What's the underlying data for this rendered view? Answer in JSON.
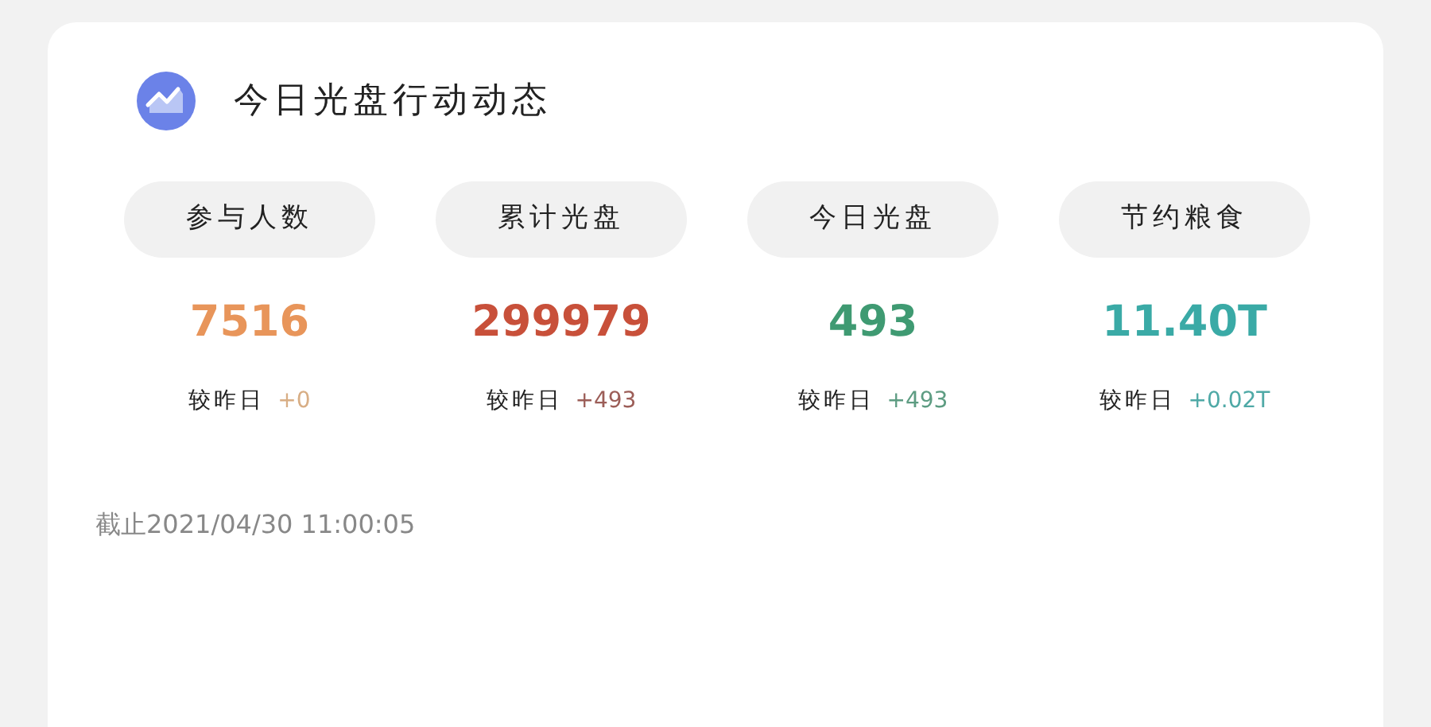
{
  "title": "今日光盘行动动态",
  "stats": [
    {
      "label": "参与人数",
      "value": "7516",
      "color": "#e8955a",
      "compare_label": "较昨日",
      "delta": {
        "text": "+0",
        "color": "#d8ae85"
      }
    },
    {
      "label": "累计光盘",
      "value": "299979",
      "color": "#c8503a",
      "compare_label": "较昨日",
      "delta": {
        "text": "+493",
        "color": "#9c5e58"
      }
    },
    {
      "label": "今日光盘",
      "value": "493",
      "color": "#3f9a72",
      "compare_label": "较昨日",
      "delta": {
        "text": "+493",
        "color": "#5d9c82"
      }
    },
    {
      "label": "节约粮食",
      "value": "11.40T",
      "color": "#3aaaa6",
      "compare_label": "较昨日",
      "delta": {
        "text": "+0.02T",
        "color": "#4fa9a6"
      }
    }
  ],
  "as_of": "截止2021/04/30 11:00:05"
}
